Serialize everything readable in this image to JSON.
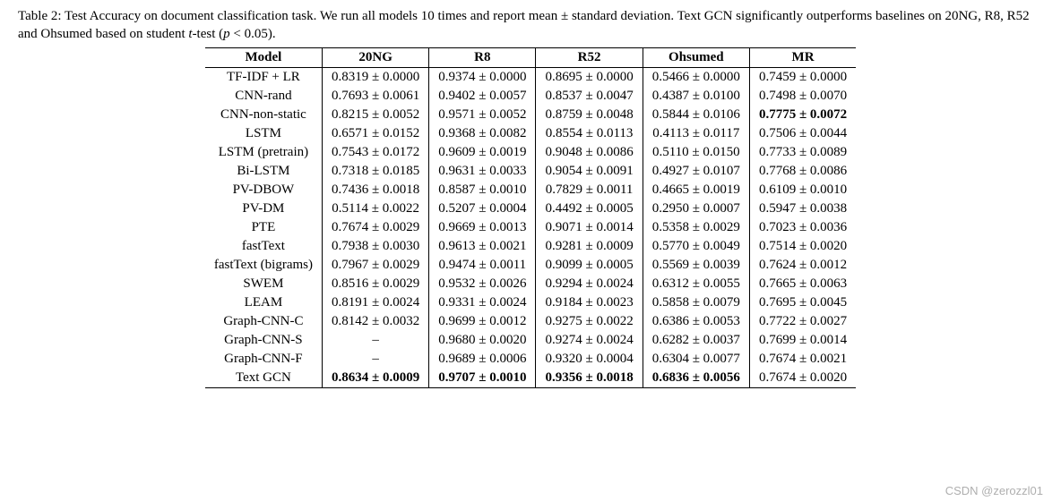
{
  "caption_prefix": "Table 2: Test Accuracy on document classification task. We run all models 10 times and report mean ± standard deviation. Text GCN significantly outperforms baselines on 20NG, R8, R52 and Ohsumed based on student ",
  "caption_ttest": "t",
  "caption_mid": "-test (",
  "caption_p": "p",
  "caption_cond": " < 0.05).",
  "headers": [
    "Model",
    "20NG",
    "R8",
    "R52",
    "Ohsumed",
    "MR"
  ],
  "chart_data": {
    "type": "table",
    "title": "Test Accuracy on document classification task",
    "columns": [
      "Model",
      "20NG",
      "R8",
      "R52",
      "Ohsumed",
      "MR"
    ],
    "rows": [
      {
        "model": "TF-IDF + LR",
        "cells": [
          "0.8319 ± 0.0000",
          "0.9374 ± 0.0000",
          "0.8695 ± 0.0000",
          "0.5466 ± 0.0000",
          "0.7459 ± 0.0000"
        ],
        "bold": [
          false,
          false,
          false,
          false,
          false
        ]
      },
      {
        "model": "CNN-rand",
        "cells": [
          "0.7693 ± 0.0061",
          "0.9402 ± 0.0057",
          "0.8537 ± 0.0047",
          "0.4387 ± 0.0100",
          "0.7498 ± 0.0070"
        ],
        "bold": [
          false,
          false,
          false,
          false,
          false
        ]
      },
      {
        "model": "CNN-non-static",
        "cells": [
          "0.8215 ± 0.0052",
          "0.9571 ± 0.0052",
          "0.8759 ± 0.0048",
          "0.5844 ± 0.0106",
          "0.7775 ± 0.0072"
        ],
        "bold": [
          false,
          false,
          false,
          false,
          true
        ]
      },
      {
        "model": "LSTM",
        "cells": [
          "0.6571 ± 0.0152",
          "0.9368 ± 0.0082",
          "0.8554 ± 0.0113",
          "0.4113 ± 0.0117",
          "0.7506 ± 0.0044"
        ],
        "bold": [
          false,
          false,
          false,
          false,
          false
        ]
      },
      {
        "model": "LSTM (pretrain)",
        "cells": [
          "0.7543 ± 0.0172",
          "0.9609 ± 0.0019",
          "0.9048 ± 0.0086",
          "0.5110 ± 0.0150",
          "0.7733 ± 0.0089"
        ],
        "bold": [
          false,
          false,
          false,
          false,
          false
        ]
      },
      {
        "model": "Bi-LSTM",
        "cells": [
          "0.7318 ± 0.0185",
          "0.9631 ± 0.0033",
          "0.9054 ± 0.0091",
          "0.4927 ± 0.0107",
          "0.7768 ± 0.0086"
        ],
        "bold": [
          false,
          false,
          false,
          false,
          false
        ]
      },
      {
        "model": "PV-DBOW",
        "cells": [
          "0.7436 ± 0.0018",
          "0.8587 ± 0.0010",
          "0.7829 ± 0.0011",
          "0.4665 ± 0.0019",
          "0.6109 ± 0.0010"
        ],
        "bold": [
          false,
          false,
          false,
          false,
          false
        ]
      },
      {
        "model": "PV-DM",
        "cells": [
          "0.5114 ± 0.0022",
          "0.5207 ± 0.0004",
          "0.4492 ± 0.0005",
          "0.2950 ± 0.0007",
          "0.5947 ± 0.0038"
        ],
        "bold": [
          false,
          false,
          false,
          false,
          false
        ]
      },
      {
        "model": "PTE",
        "cells": [
          "0.7674 ± 0.0029",
          "0.9669 ± 0.0013",
          "0.9071 ± 0.0014",
          "0.5358 ± 0.0029",
          "0.7023 ± 0.0036"
        ],
        "bold": [
          false,
          false,
          false,
          false,
          false
        ]
      },
      {
        "model": "fastText",
        "cells": [
          "0.7938 ± 0.0030",
          "0.9613 ± 0.0021",
          "0.9281 ± 0.0009",
          "0.5770 ± 0.0049",
          "0.7514 ± 0.0020"
        ],
        "bold": [
          false,
          false,
          false,
          false,
          false
        ]
      },
      {
        "model": "fastText (bigrams)",
        "cells": [
          "0.7967 ± 0.0029",
          "0.9474 ± 0.0011",
          "0.9099 ± 0.0005",
          "0.5569 ± 0.0039",
          "0.7624 ± 0.0012"
        ],
        "bold": [
          false,
          false,
          false,
          false,
          false
        ]
      },
      {
        "model": "SWEM",
        "cells": [
          "0.8516 ± 0.0029",
          "0.9532 ± 0.0026",
          "0.9294 ± 0.0024",
          "0.6312 ± 0.0055",
          "0.7665 ± 0.0063"
        ],
        "bold": [
          false,
          false,
          false,
          false,
          false
        ]
      },
      {
        "model": "LEAM",
        "cells": [
          "0.8191 ± 0.0024",
          "0.9331 ± 0.0024",
          "0.9184 ± 0.0023",
          "0.5858 ± 0.0079",
          "0.7695 ± 0.0045"
        ],
        "bold": [
          false,
          false,
          false,
          false,
          false
        ]
      },
      {
        "model": "Graph-CNN-C",
        "cells": [
          "0.8142 ± 0.0032",
          "0.9699 ± 0.0012",
          "0.9275 ± 0.0022",
          "0.6386 ± 0.0053",
          "0.7722 ± 0.0027"
        ],
        "bold": [
          false,
          false,
          false,
          false,
          false
        ]
      },
      {
        "model": "Graph-CNN-S",
        "cells": [
          "–",
          "0.9680 ± 0.0020",
          "0.9274 ± 0.0024",
          "0.6282 ± 0.0037",
          "0.7699 ± 0.0014"
        ],
        "bold": [
          false,
          false,
          false,
          false,
          false
        ]
      },
      {
        "model": "Graph-CNN-F",
        "cells": [
          "–",
          "0.9689 ± 0.0006",
          "0.9320 ± 0.0004",
          "0.6304 ± 0.0077",
          "0.7674 ± 0.0021"
        ],
        "bold": [
          false,
          false,
          false,
          false,
          false
        ]
      },
      {
        "model": "Text GCN",
        "cells": [
          "0.8634 ± 0.0009",
          "0.9707 ± 0.0010",
          "0.9356 ± 0.0018",
          "0.6836 ± 0.0056",
          "0.7674 ± 0.0020"
        ],
        "bold": [
          true,
          true,
          true,
          true,
          false
        ]
      }
    ]
  },
  "watermark": "CSDN @zerozzl01"
}
